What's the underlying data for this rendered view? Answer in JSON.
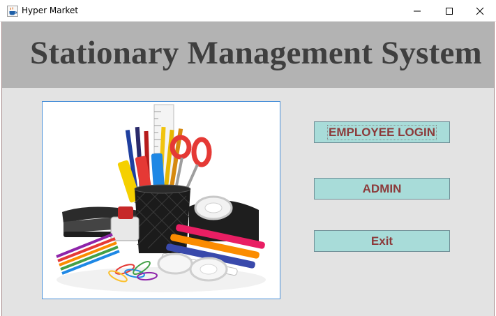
{
  "window": {
    "title": "Hyper Market",
    "icon": "java-cup-icon",
    "controls": [
      "minimize-icon",
      "maximize-icon",
      "close-icon"
    ]
  },
  "header": {
    "title": "Stationary Management System"
  },
  "image": {
    "subject": "stationery-supplies-photo"
  },
  "buttons": {
    "employee_login": "EMPLOYEE LOGIN",
    "admin": "ADMIN",
    "exit": "Exit"
  },
  "colors": {
    "header_band": "#b3b3b3",
    "title_text": "#3f3f3f",
    "content_bg": "#e3e3e3",
    "button_bg": "#a8dcd9",
    "button_text": "#8c3a3a",
    "image_border": "#4a90d9"
  }
}
